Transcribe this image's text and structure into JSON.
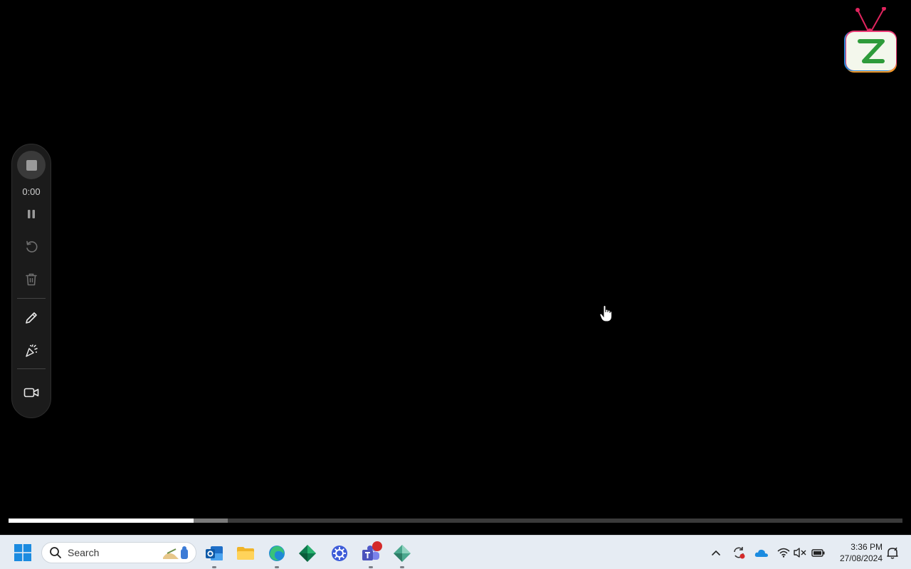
{
  "recorder": {
    "elapsed": "0:00"
  },
  "video": {
    "played_fraction": 0.207,
    "buffered_fraction": 0.245
  },
  "taskbar": {
    "search_placeholder": "Search",
    "apps": [
      "outlook-icon",
      "file-explorer-icon",
      "edge-icon",
      "diamond-app-icon",
      "settings-gear-icon",
      "teams-icon",
      "diamond-app-2-icon"
    ],
    "clock_time": "3:36 PM",
    "clock_date": "27/08/2024"
  },
  "colors": {
    "background": "#000000",
    "toolbar": "#1b1b1b",
    "taskbar": "#e6ecf3",
    "progress_played": "#ffffff",
    "badge": "#d42a2a"
  }
}
